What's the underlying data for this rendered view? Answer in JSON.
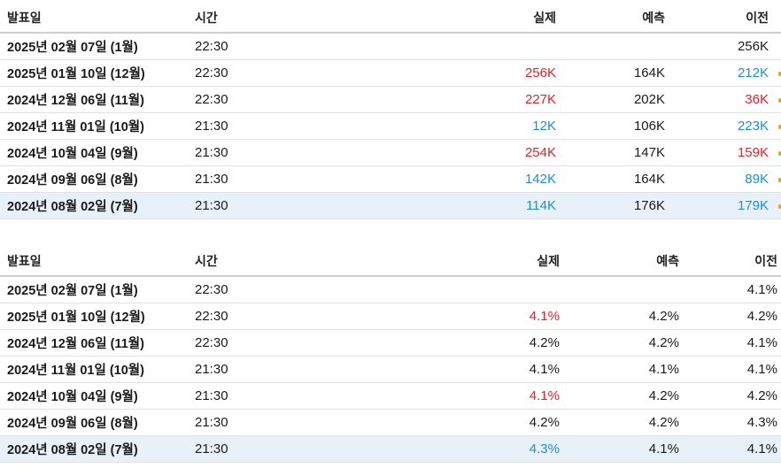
{
  "colors": {
    "up": "#ee1c25",
    "down": "#1b8fd8",
    "normal": "#1a1a1a",
    "highlight_row": "#e8f1fa"
  },
  "tables": [
    {
      "headers": {
        "date": "발표일",
        "time": "시간",
        "actual": "실제",
        "forecast": "예측",
        "previous": "이전"
      },
      "rows": [
        {
          "date": "2025년 02월 07일 (1월)",
          "time": "22:30",
          "actual": "",
          "actual_color": "normal",
          "forecast": "",
          "previous": "256K",
          "previous_color": "normal",
          "highlight": false,
          "marker": false
        },
        {
          "date": "2025년 01월 10일 (12월)",
          "time": "22:30",
          "actual": "256K",
          "actual_color": "up",
          "forecast": "164K",
          "previous": "212K",
          "previous_color": "down",
          "highlight": false,
          "marker": true
        },
        {
          "date": "2024년 12월 06일 (11월)",
          "time": "22:30",
          "actual": "227K",
          "actual_color": "up",
          "forecast": "202K",
          "previous": "36K",
          "previous_color": "up",
          "highlight": false,
          "marker": true
        },
        {
          "date": "2024년 11월 01일 (10월)",
          "time": "21:30",
          "actual": "12K",
          "actual_color": "down",
          "forecast": "106K",
          "previous": "223K",
          "previous_color": "down",
          "highlight": false,
          "marker": true
        },
        {
          "date": "2024년 10월 04일 (9월)",
          "time": "21:30",
          "actual": "254K",
          "actual_color": "up",
          "forecast": "147K",
          "previous": "159K",
          "previous_color": "up",
          "highlight": false,
          "marker": true
        },
        {
          "date": "2024년 09월 06일 (8월)",
          "time": "21:30",
          "actual": "142K",
          "actual_color": "down",
          "forecast": "164K",
          "previous": "89K",
          "previous_color": "down",
          "highlight": false,
          "marker": true
        },
        {
          "date": "2024년 08월 02일 (7월)",
          "time": "21:30",
          "actual": "114K",
          "actual_color": "down",
          "forecast": "176K",
          "previous": "179K",
          "previous_color": "down",
          "highlight": true,
          "marker": true
        }
      ]
    },
    {
      "headers": {
        "date": "발표일",
        "time": "시간",
        "actual": "실제",
        "forecast": "예측",
        "previous": "이전"
      },
      "rows": [
        {
          "date": "2025년 02월 07일 (1월)",
          "time": "22:30",
          "actual": "",
          "actual_color": "normal",
          "forecast": "",
          "previous": "4.1%",
          "previous_color": "normal",
          "highlight": false,
          "marker": false
        },
        {
          "date": "2025년 01월 10일 (12월)",
          "time": "22:30",
          "actual": "4.1%",
          "actual_color": "up",
          "forecast": "4.2%",
          "previous": "4.2%",
          "previous_color": "normal",
          "highlight": false,
          "marker": false
        },
        {
          "date": "2024년 12월 06일 (11월)",
          "time": "22:30",
          "actual": "4.2%",
          "actual_color": "normal",
          "forecast": "4.2%",
          "previous": "4.1%",
          "previous_color": "normal",
          "highlight": false,
          "marker": false
        },
        {
          "date": "2024년 11월 01일 (10월)",
          "time": "21:30",
          "actual": "4.1%",
          "actual_color": "normal",
          "forecast": "4.1%",
          "previous": "4.1%",
          "previous_color": "normal",
          "highlight": false,
          "marker": false
        },
        {
          "date": "2024년 10월 04일 (9월)",
          "time": "21:30",
          "actual": "4.1%",
          "actual_color": "up",
          "forecast": "4.2%",
          "previous": "4.2%",
          "previous_color": "normal",
          "highlight": false,
          "marker": false
        },
        {
          "date": "2024년 09월 06일 (8월)",
          "time": "21:30",
          "actual": "4.2%",
          "actual_color": "normal",
          "forecast": "4.2%",
          "previous": "4.3%",
          "previous_color": "normal",
          "highlight": false,
          "marker": false
        },
        {
          "date": "2024년 08월 02일 (7월)",
          "time": "21:30",
          "actual": "4.3%",
          "actual_color": "down",
          "forecast": "4.1%",
          "previous": "4.1%",
          "previous_color": "normal",
          "highlight": true,
          "marker": false
        }
      ]
    }
  ]
}
